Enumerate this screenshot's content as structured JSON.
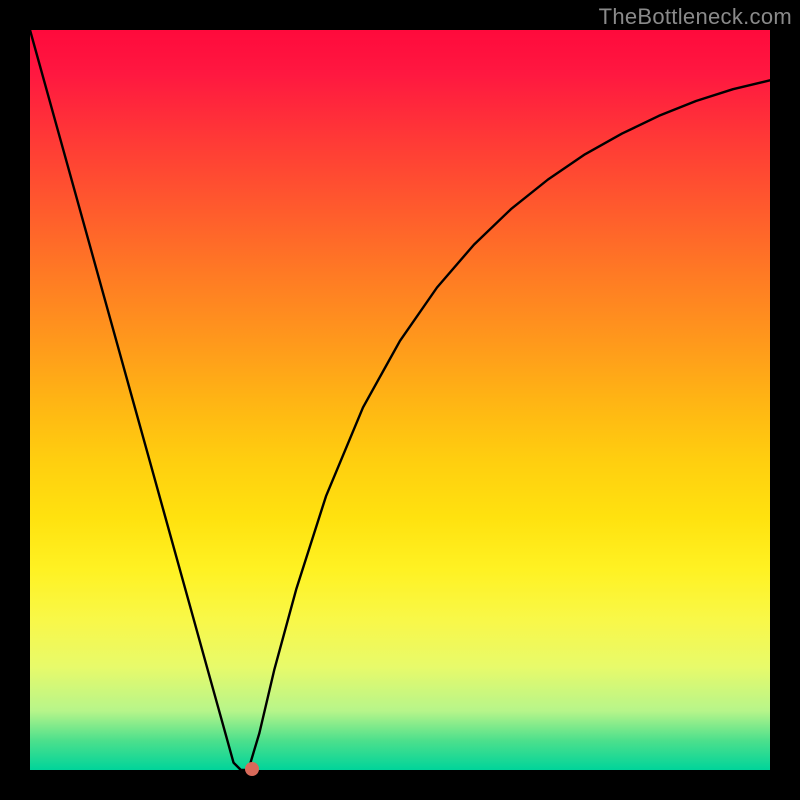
{
  "watermark": "TheBottleneck.com",
  "chart_data": {
    "type": "line",
    "title": "",
    "xlabel": "",
    "ylabel": "",
    "x": [
      0.0,
      0.02,
      0.04,
      0.06,
      0.08,
      0.1,
      0.12,
      0.14,
      0.16,
      0.18,
      0.2,
      0.22,
      0.24,
      0.26,
      0.275,
      0.285,
      0.295,
      0.31,
      0.33,
      0.36,
      0.4,
      0.45,
      0.5,
      0.55,
      0.6,
      0.65,
      0.7,
      0.75,
      0.8,
      0.85,
      0.9,
      0.95,
      1.0
    ],
    "y": [
      1.0,
      0.928,
      0.856,
      0.784,
      0.712,
      0.64,
      0.568,
      0.496,
      0.424,
      0.352,
      0.28,
      0.208,
      0.136,
      0.064,
      0.01,
      0.0,
      0.0,
      0.05,
      0.135,
      0.245,
      0.37,
      0.49,
      0.58,
      0.652,
      0.71,
      0.758,
      0.798,
      0.832,
      0.86,
      0.884,
      0.904,
      0.92,
      0.932
    ],
    "xlim": [
      0,
      1
    ],
    "ylim": [
      0,
      1
    ],
    "grid": false,
    "background_gradient": {
      "top": "#ff0a3c",
      "middle": "#ffe20f",
      "bottom": "#00d49a"
    },
    "marker": {
      "x": 0.3,
      "y": 0.002,
      "color": "#d86a5a"
    }
  }
}
